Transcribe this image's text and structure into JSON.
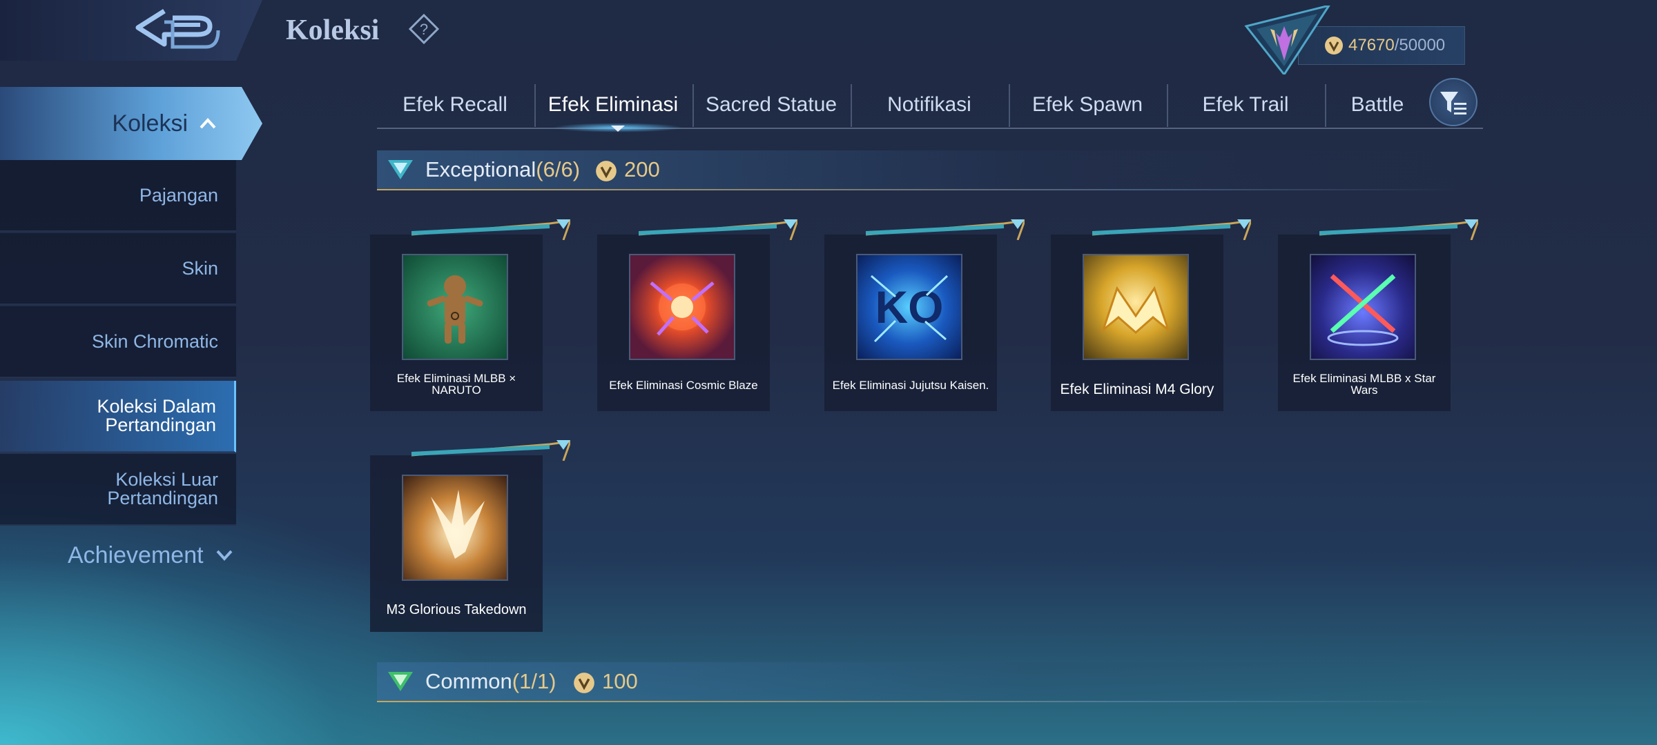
{
  "header": {
    "title": "Koleksi",
    "points_current": "47670",
    "points_max": "/50000"
  },
  "sidebar": {
    "koleksi_label": "Koleksi",
    "items": [
      {
        "label": "Pajangan"
      },
      {
        "label": "Skin"
      },
      {
        "label": "Skin Chromatic"
      },
      {
        "label_line1": "Koleksi Dalam",
        "label_line2": "Pertandingan",
        "active": true
      },
      {
        "label_line1": "Koleksi Luar",
        "label_line2": "Pertandingan"
      }
    ],
    "achievement_label": "Achievement"
  },
  "tabs": [
    {
      "label": "Efek Recall"
    },
    {
      "label": "Efek Eliminasi",
      "active": true
    },
    {
      "label": "Sacred Statue"
    },
    {
      "label": "Notifikasi"
    },
    {
      "label": "Efek Spawn"
    },
    {
      "label": "Efek Trail"
    },
    {
      "label": "Battle"
    }
  ],
  "sections": {
    "exceptional": {
      "title": "Exceptional",
      "count": "(6/6)",
      "points": "200"
    },
    "common": {
      "title": "Common",
      "count": "(1/1)",
      "points": "100"
    }
  },
  "items": [
    {
      "label": "Efek Eliminasi MLBB × NARUTO",
      "icon": "naruto-doll-icon"
    },
    {
      "label": "Efek Eliminasi Cosmic Blaze",
      "icon": "cosmic-blaze-icon"
    },
    {
      "label": "Efek Eliminasi Jujutsu Kaisen.",
      "icon": "jujutsu-ko-icon"
    },
    {
      "label": "Efek Eliminasi M4 Glory",
      "icon": "m4-glory-icon"
    },
    {
      "label": "Efek Eliminasi MLBB x Star Wars",
      "icon": "star-wars-sabers-icon"
    },
    {
      "label": "M3 Glorious Takedown",
      "icon": "m3-takedown-icon"
    }
  ],
  "colors": {
    "accent_gold": "#e6c98a",
    "active_blue": "#5da0d8",
    "text_light": "#c9d8ef"
  }
}
